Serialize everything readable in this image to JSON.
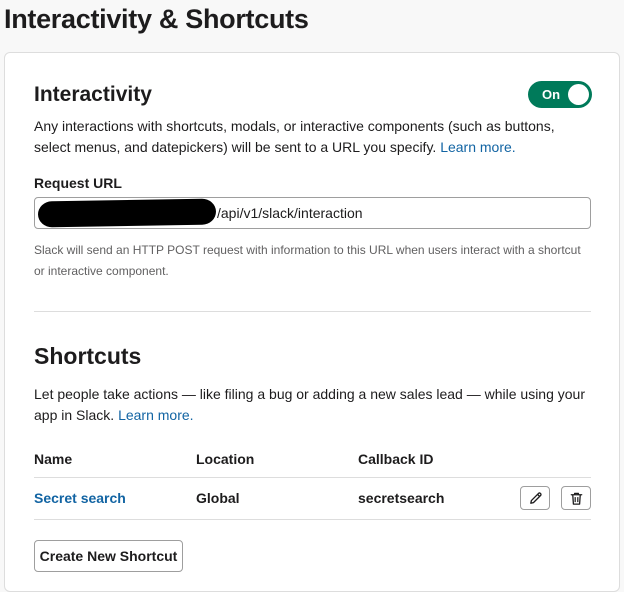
{
  "page": {
    "title": "Interactivity & Shortcuts"
  },
  "interactivity": {
    "title": "Interactivity",
    "toggle_label": "On",
    "description": "Any interactions with shortcuts, modals, or interactive components (such as buttons, select menus, and datepickers) will be sent to a URL you specify.",
    "learn_more": "Learn more.",
    "request_url_label": "Request URL",
    "request_url_visible": "/api/v1/slack/interaction",
    "hint": "Slack will send an HTTP POST request with information to this URL when users interact with a shortcut or interactive component."
  },
  "shortcuts": {
    "title": "Shortcuts",
    "description": "Let people take actions — like filing a bug or adding a new sales lead — while using your app in Slack.",
    "learn_more": "Learn more.",
    "columns": [
      "Name",
      "Location",
      "Callback ID"
    ],
    "rows": [
      {
        "name": "Secret search",
        "location": "Global",
        "callback_id": "secretsearch"
      }
    ],
    "create_button": "Create New Shortcut"
  },
  "colors": {
    "toggle_on": "#007a5a",
    "link": "#1264a3",
    "text": "#1d1c1d",
    "muted": "#616061"
  },
  "icons": {
    "edit": "pencil-icon",
    "delete": "trash-icon"
  }
}
